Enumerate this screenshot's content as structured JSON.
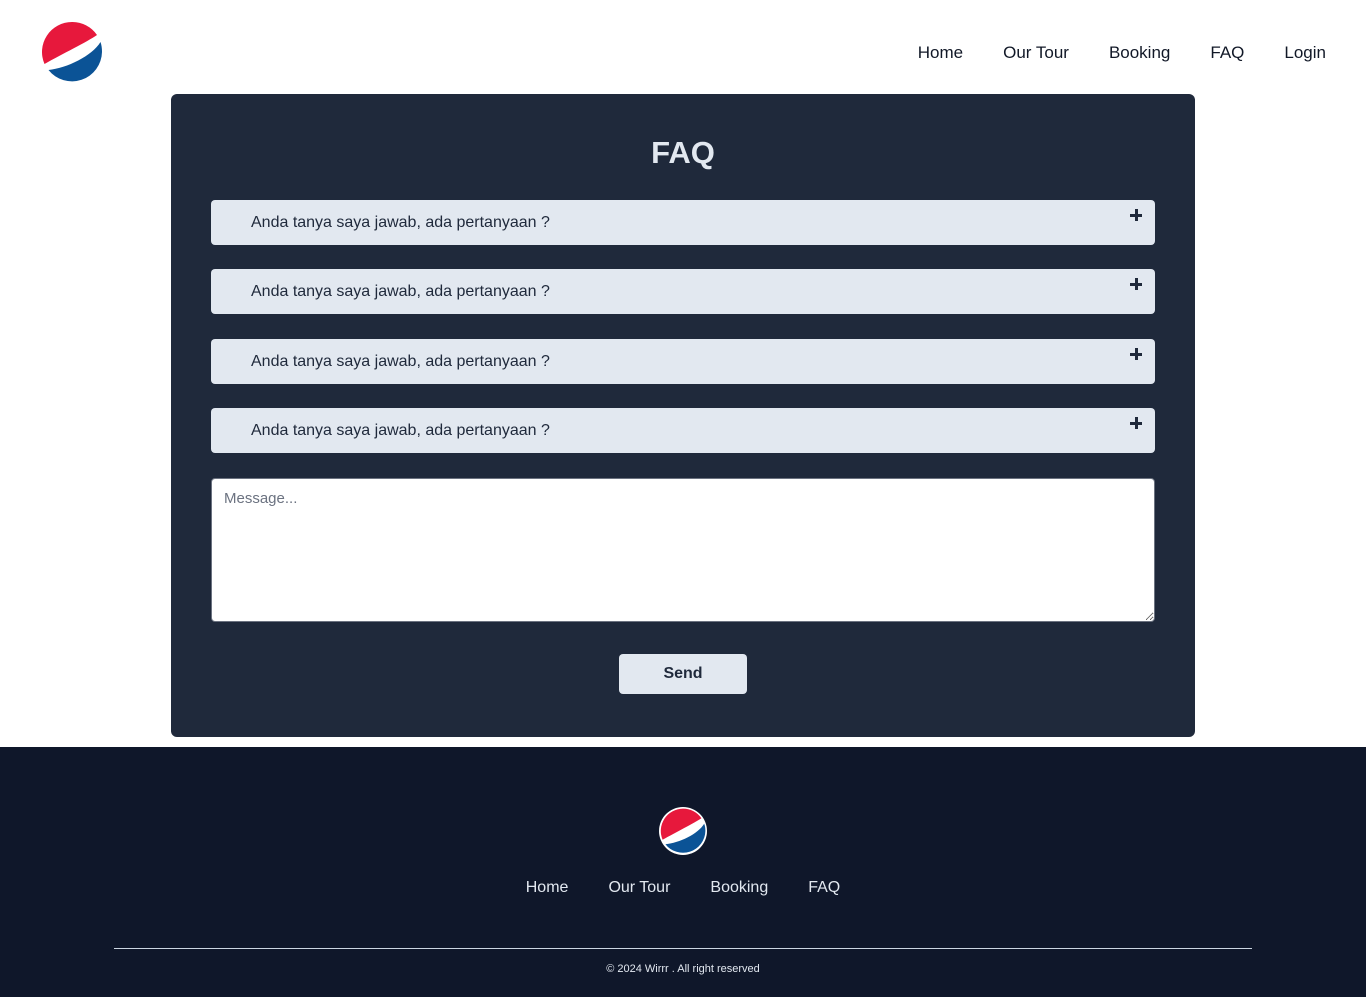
{
  "header": {
    "logo": "pepsi-globe-logo",
    "nav": [
      "Home",
      "Our Tour",
      "Booking",
      "FAQ",
      "Login"
    ]
  },
  "faq": {
    "title": "FAQ",
    "items": [
      {
        "question": "Anda tanya saya jawab, ada pertanyaan ?",
        "icon": "plus-icon"
      },
      {
        "question": "Anda tanya saya jawab, ada pertanyaan ?",
        "icon": "plus-icon"
      },
      {
        "question": "Anda tanya saya jawab, ada pertanyaan ?",
        "icon": "plus-icon"
      },
      {
        "question": "Anda tanya saya jawab, ada pertanyaan ?",
        "icon": "plus-icon"
      }
    ],
    "message_placeholder": "Message...",
    "send_label": "Send"
  },
  "footer": {
    "logo": "pepsi-globe-logo",
    "nav": [
      "Home",
      "Our Tour",
      "Booking",
      "FAQ"
    ],
    "copyright": "© 2024 Wirrr . All right reserved"
  },
  "colors": {
    "card_bg": "#1f293b",
    "footer_bg": "#0f172a",
    "item_bg": "#e2e8f0",
    "logo_red": "#e7183c",
    "logo_blue": "#0b5396"
  }
}
